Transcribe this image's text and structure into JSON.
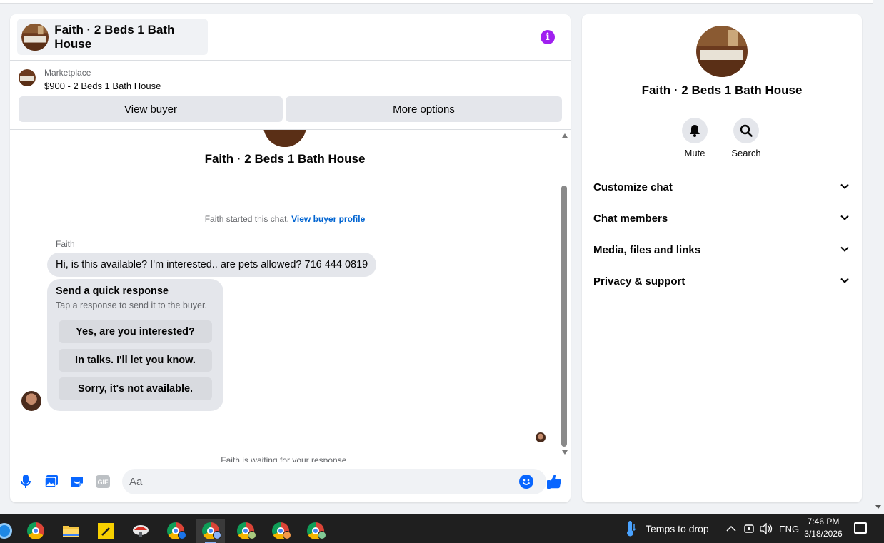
{
  "chat": {
    "title": "Faith · 2 Beds 1 Bath House",
    "marketplace_label": "Marketplace",
    "listing": "$900 - 2 Beds 1 Bath House",
    "view_buyer": "View buyer",
    "more_options": "More options",
    "convo_title": "Faith · 2 Beds 1 Bath House",
    "started_text": "Faith started this chat.",
    "view_buyer_profile": "View buyer profile",
    "sender_name": "Faith",
    "message": "Hi, is this available? I'm interested.. are pets allowed? 716 444 0819",
    "quick_response": {
      "heading": "Send a quick response",
      "subtitle": "Tap a response to send it to the buyer.",
      "options": [
        "Yes, are you interested?",
        "In talks. I'll let you know.",
        "Sorry, it's not available."
      ]
    },
    "waiting": "Faith is waiting for your response.",
    "input_placeholder": "Aa",
    "gif_label": "GIF",
    "accent_color": "#0866ff",
    "info_color": "#a020f0"
  },
  "side": {
    "name": "Faith · 2 Beds 1 Bath House",
    "mute": "Mute",
    "search": "Search",
    "sections": [
      "Customize chat",
      "Chat members",
      "Media, files and links",
      "Privacy & support"
    ]
  },
  "taskbar": {
    "weather": "Temps to drop",
    "language": "ENG",
    "time": "7:46 PM",
    "date": "3/18/2026"
  }
}
